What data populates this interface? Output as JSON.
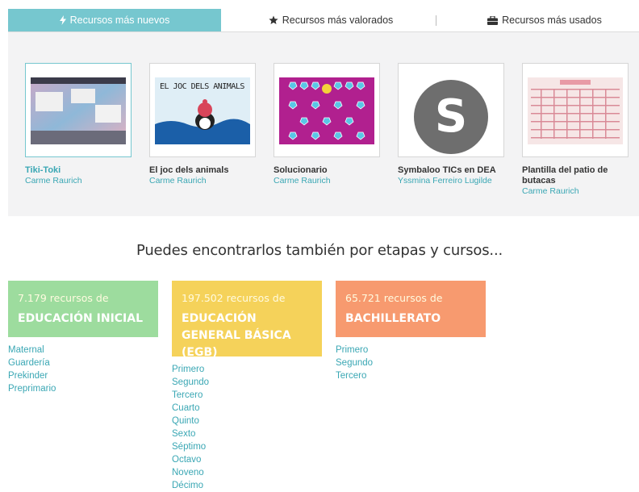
{
  "tabs": [
    {
      "label": "Recursos más nuevos",
      "icon": "bolt-icon",
      "active": true
    },
    {
      "label": "Recursos más valorados",
      "icon": "star-icon",
      "active": false
    },
    {
      "label": "Recursos más usados",
      "icon": "briefcase-icon",
      "active": false
    }
  ],
  "cards": [
    {
      "title": "Tiki-Toki",
      "author": "Carme Raurich"
    },
    {
      "title": "El joc dels animals",
      "author": "Carme Raurich",
      "thumb_text": "EL JOC DELS ANIMALS"
    },
    {
      "title": "Solucionario",
      "author": "Carme Raurich"
    },
    {
      "title": "Symbaloo TICs en DEA",
      "author": "Yssmina Ferreiro Lugilde",
      "thumb_letter": "S"
    },
    {
      "title": "Plantilla del patio de butacas",
      "author": "Carme Raurich"
    }
  ],
  "heading": "Puedes encontrarlos también por etapas y cursos...",
  "stages": [
    {
      "count": "7.179 recursos de",
      "name": "EDUCACIÓN INICIAL",
      "color": "#9ddc9e",
      "links": [
        "Maternal",
        "Guardería",
        "Prekinder",
        "Preprimario"
      ]
    },
    {
      "count": "197.502 recursos de",
      "name": "EDUCACIÓN GENERAL BÁSICA (EGB)",
      "color": "#f5d25a",
      "links": [
        "Primero",
        "Segundo",
        "Tercero",
        "Cuarto",
        "Quinto",
        "Sexto",
        "Séptimo",
        "Octavo",
        "Noveno",
        "Décimo"
      ]
    },
    {
      "count": "65.721 recursos de",
      "name": "BACHILLERATO",
      "color": "#f79a6f",
      "links": [
        "Primero",
        "Segundo",
        "Tercero"
      ]
    }
  ]
}
